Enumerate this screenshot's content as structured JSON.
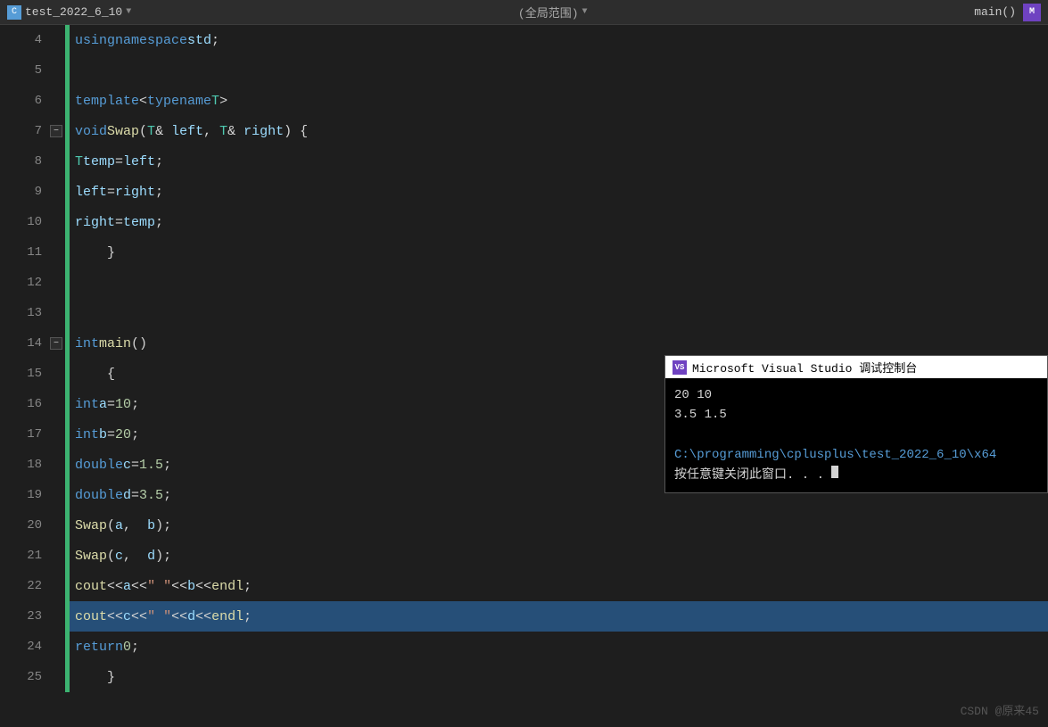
{
  "topbar": {
    "file_icon_text": "C",
    "file_name": "test_2022_6_10",
    "scope_label": "(全局范围)",
    "function_label": "main()",
    "main_icon": "M"
  },
  "console": {
    "title": "Microsoft Visual Studio 调试控制台",
    "icon_text": "vs",
    "output_line1": "20 10",
    "output_line2": "3.5 1.5",
    "output_line3": "",
    "path_text": "C:\\programming\\cplusplus\\test_2022_6_10\\x64",
    "hint_text": "按任意键关闭此窗口. . ."
  },
  "watermark": "CSDN @原来45",
  "lines": [
    {
      "num": "4",
      "fold": "",
      "code": "    using namespace std;"
    },
    {
      "num": "5",
      "fold": "",
      "code": ""
    },
    {
      "num": "6",
      "fold": "",
      "code": "    template<typename T>"
    },
    {
      "num": "7",
      "fold": "−",
      "code": "    void Swap(T& left, T& right) {"
    },
    {
      "num": "8",
      "fold": "",
      "code": "        T temp = left;"
    },
    {
      "num": "9",
      "fold": "",
      "code": "        left = right;"
    },
    {
      "num": "10",
      "fold": "",
      "code": "        right = temp;"
    },
    {
      "num": "11",
      "fold": "",
      "code": "    }"
    },
    {
      "num": "12",
      "fold": "",
      "code": ""
    },
    {
      "num": "13",
      "fold": "",
      "code": ""
    },
    {
      "num": "14",
      "fold": "−",
      "code": "    int main()"
    },
    {
      "num": "15",
      "fold": "",
      "code": "    {"
    },
    {
      "num": "16",
      "fold": "",
      "code": "        int a = 10;"
    },
    {
      "num": "17",
      "fold": "",
      "code": "        int b = 20;"
    },
    {
      "num": "18",
      "fold": "",
      "code": "        double c = 1.5;"
    },
    {
      "num": "19",
      "fold": "",
      "code": "        double d = 3.5;"
    },
    {
      "num": "20",
      "fold": "",
      "code": "        Swap(a,  b);"
    },
    {
      "num": "21",
      "fold": "",
      "code": "        Swap(c,  d);"
    },
    {
      "num": "22",
      "fold": "",
      "code": "        cout << a << \" \" << b << endl;"
    },
    {
      "num": "23",
      "fold": "",
      "code": "        cout << c << \" \" << d << endl;",
      "highlight": true
    },
    {
      "num": "24",
      "fold": "",
      "code": "        return 0;"
    },
    {
      "num": "25",
      "fold": "",
      "code": "    }"
    }
  ]
}
